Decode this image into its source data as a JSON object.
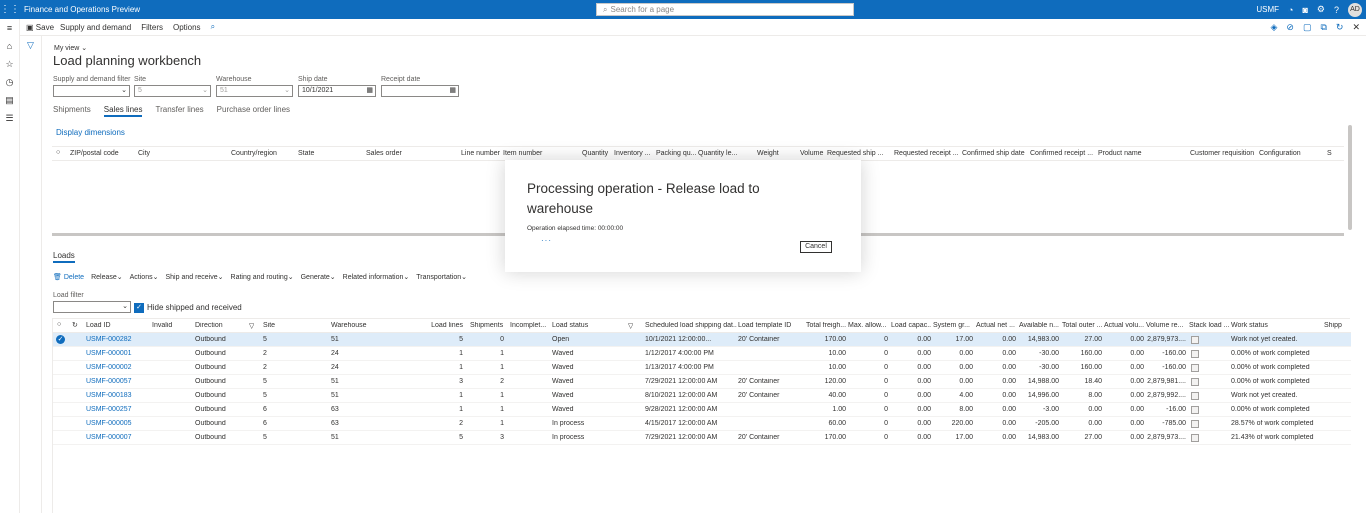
{
  "topbar": {
    "app_title": "Finance and Operations Preview",
    "search_placeholder": "Search for a page",
    "company": "USMF",
    "user_initials": "AD"
  },
  "actionbar": {
    "save": "Save",
    "supply_and_demand": "Supply and demand",
    "filters": "Filters",
    "options": "Options"
  },
  "page": {
    "my_view": "My view",
    "title": "Load planning workbench"
  },
  "filters": {
    "supply_demand_label": "Supply and demand filter",
    "site_label": "Site",
    "site_value": "5",
    "warehouse_label": "Warehouse",
    "warehouse_value": "51",
    "ship_date_label": "Ship date",
    "ship_date_value": "10/1/2021",
    "receipt_date_label": "Receipt date"
  },
  "tabs": [
    "Shipments",
    "Sales lines",
    "Transfer lines",
    "Purchase order lines"
  ],
  "sales_lines": {
    "display_dimensions": "Display dimensions",
    "columns": [
      "ZIP/postal code",
      "City",
      "Country/region",
      "State",
      "Sales order",
      "Line number",
      "Item number",
      "Quantity",
      "Inventory ...",
      "Packing qu...",
      "Quantity le...",
      "Weight",
      "Volume",
      "Requested ship ...",
      "Requested receipt ...",
      "Confirmed ship date",
      "Confirmed receipt ...",
      "Product name",
      "Customer requisition",
      "Configuration",
      "S"
    ]
  },
  "dialog": {
    "title": "Processing operation - Release load to warehouse",
    "elapsed": "Operation elapsed time: 00:00:00",
    "cancel": "Cancel"
  },
  "loads": {
    "label": "Loads",
    "actions": [
      "Delete",
      "Release",
      "Actions",
      "Ship and receive",
      "Rating and routing",
      "Generate",
      "Related information",
      "Transportation"
    ],
    "filter_label": "Load filter",
    "hide_shipped": "Hide shipped and received",
    "columns": [
      "Load ID",
      "Invalid",
      "Direction",
      "Site",
      "Warehouse",
      "Load lines",
      "Shipments",
      "Incomplet...",
      "Load status",
      "Scheduled load shipping dat...",
      "Load template ID",
      "Total freigh...",
      "Max. allow...",
      "Load capac...",
      "System gr...",
      "Actual net ...",
      "Available n...",
      "Total outer ...",
      "Actual volu...",
      "Volume re...",
      "Stack load ...",
      "Work status",
      "Shipp"
    ],
    "rows": [
      {
        "id": "USMF-000282",
        "direction": "Outbound",
        "site": "5",
        "warehouse": "51",
        "load_lines": "5",
        "shipments": "0",
        "status": "Open",
        "sched": "10/1/2021 12:00:00...",
        "template": "20' Container",
        "freight": "170.00",
        "max": "0",
        "cap": "0.00",
        "sysgr": "17.00",
        "actnet": "0.00",
        "avail": "14,983.00",
        "outer": "27.00",
        "actvol": "0.00",
        "volre": "2,879,973....",
        "work": "Work not yet created."
      },
      {
        "id": "USMF-000001",
        "direction": "Outbound",
        "site": "2",
        "warehouse": "24",
        "load_lines": "1",
        "shipments": "1",
        "status": "Waved",
        "sched": "1/12/2017 4:00:00 PM",
        "template": "",
        "freight": "10.00",
        "max": "0",
        "cap": "0.00",
        "sysgr": "0.00",
        "actnet": "0.00",
        "avail": "-30.00",
        "outer": "160.00",
        "actvol": "0.00",
        "volre": "-160.00",
        "work": "0.00% of work completed"
      },
      {
        "id": "USMF-000002",
        "direction": "Outbound",
        "site": "2",
        "warehouse": "24",
        "load_lines": "1",
        "shipments": "1",
        "status": "Waved",
        "sched": "1/13/2017 4:00:00 PM",
        "template": "",
        "freight": "10.00",
        "max": "0",
        "cap": "0.00",
        "sysgr": "0.00",
        "actnet": "0.00",
        "avail": "-30.00",
        "outer": "160.00",
        "actvol": "0.00",
        "volre": "-160.00",
        "work": "0.00% of work completed"
      },
      {
        "id": "USMF-000057",
        "direction": "Outbound",
        "site": "5",
        "warehouse": "51",
        "load_lines": "3",
        "shipments": "2",
        "status": "Waved",
        "sched": "7/29/2021 12:00:00 AM",
        "template": "20' Container",
        "freight": "120.00",
        "max": "0",
        "cap": "0.00",
        "sysgr": "0.00",
        "actnet": "0.00",
        "avail": "14,988.00",
        "outer": "18.40",
        "actvol": "0.00",
        "volre": "2,879,981....",
        "work": "0.00% of work completed"
      },
      {
        "id": "USMF-000183",
        "direction": "Outbound",
        "site": "5",
        "warehouse": "51",
        "load_lines": "1",
        "shipments": "1",
        "status": "Waved",
        "sched": "8/10/2021 12:00:00 AM",
        "template": "20' Container",
        "freight": "40.00",
        "max": "0",
        "cap": "0.00",
        "sysgr": "4.00",
        "actnet": "0.00",
        "avail": "14,996.00",
        "outer": "8.00",
        "actvol": "0.00",
        "volre": "2,879,992....",
        "work": "Work not yet created."
      },
      {
        "id": "USMF-000257",
        "direction": "Outbound",
        "site": "6",
        "warehouse": "63",
        "load_lines": "1",
        "shipments": "1",
        "status": "Waved",
        "sched": "9/28/2021 12:00:00 AM",
        "template": "",
        "freight": "1.00",
        "max": "0",
        "cap": "0.00",
        "sysgr": "8.00",
        "actnet": "0.00",
        "avail": "-3.00",
        "outer": "0.00",
        "actvol": "0.00",
        "volre": "-16.00",
        "work": "0.00% of work completed"
      },
      {
        "id": "USMF-000005",
        "direction": "Outbound",
        "site": "6",
        "warehouse": "63",
        "load_lines": "2",
        "shipments": "1",
        "status": "In process",
        "sched": "4/15/2017 12:00:00 AM",
        "template": "",
        "freight": "60.00",
        "max": "0",
        "cap": "0.00",
        "sysgr": "220.00",
        "actnet": "0.00",
        "avail": "-205.00",
        "outer": "0.00",
        "actvol": "0.00",
        "volre": "-785.00",
        "work": "28.57% of work completed"
      },
      {
        "id": "USMF-000007",
        "direction": "Outbound",
        "site": "5",
        "warehouse": "51",
        "load_lines": "5",
        "shipments": "3",
        "status": "In process",
        "sched": "7/29/2021 12:00:00 AM",
        "template": "20' Container",
        "freight": "170.00",
        "max": "0",
        "cap": "0.00",
        "sysgr": "17.00",
        "actnet": "0.00",
        "avail": "14,983.00",
        "outer": "27.00",
        "actvol": "0.00",
        "volre": "2,879,973....",
        "work": "21.43% of work completed"
      }
    ]
  },
  "colors": {
    "brand": "#0f6cbd",
    "selected_row": "#deecf9"
  }
}
